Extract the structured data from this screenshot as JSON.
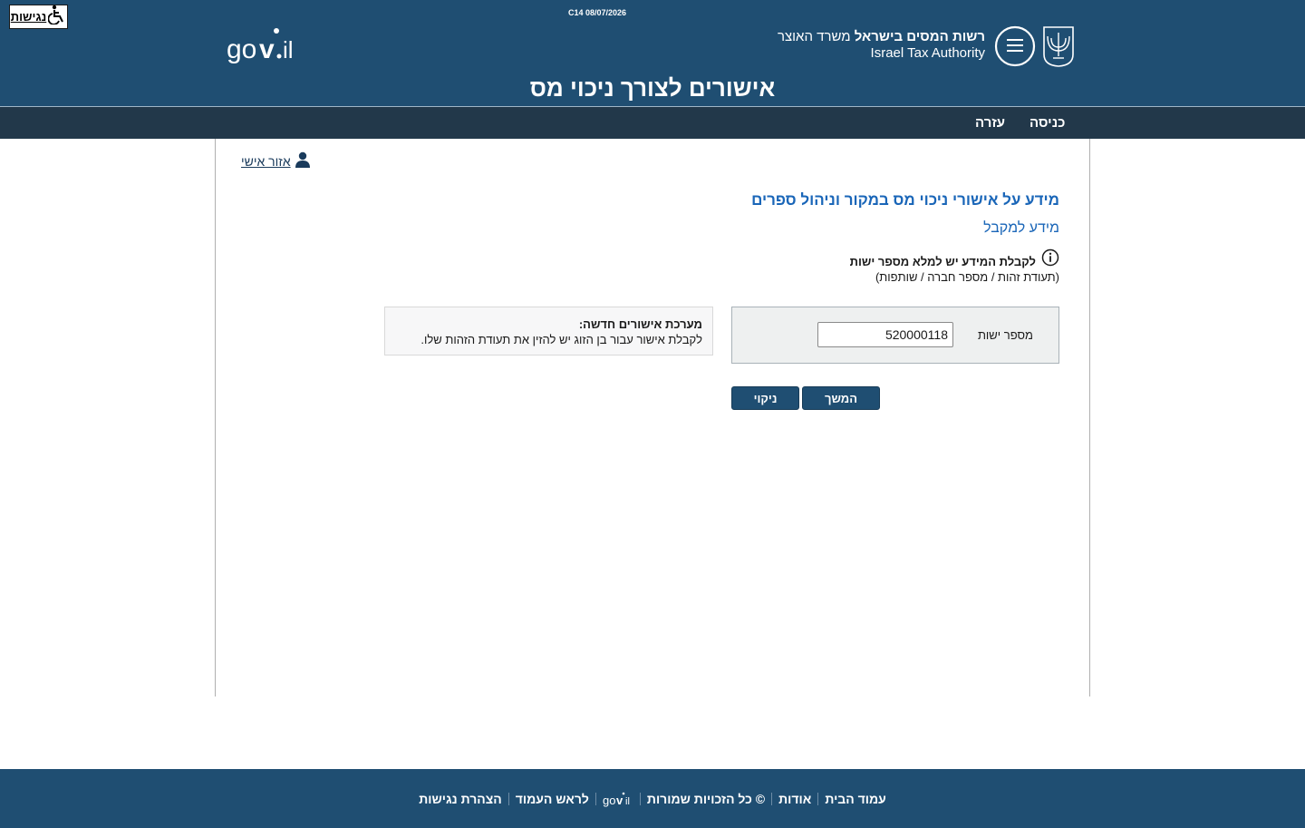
{
  "header": {
    "version": "C14 08/07/2026",
    "accessibility_label": "נגישות",
    "gov_logo_text": "gov.il",
    "org_he_bold": "רשות המסים בישראל",
    "org_he_regular": "משרד האוצר",
    "org_en": "Israel Tax Authority",
    "title": "אישורים לצורך ניכוי מס"
  },
  "nav": {
    "items": [
      {
        "label": "כניסה"
      },
      {
        "label": "עזרה"
      }
    ]
  },
  "main": {
    "personal_area": "אזור אישי",
    "heading": "מידע על אישורי ניכוי מס במקור וניהול ספרים",
    "subheading": "מידע למקבל",
    "info_text": "לקבלת המידע יש למלא מספר ישות",
    "info_sub": "(תעודת זהות / מספר חברה / שותפות)",
    "form": {
      "field_label": "מספר ישות",
      "field_value": "520000118"
    },
    "notice": {
      "title": "מערכת אישורים חדשה:",
      "text": "לקבלת אישור עבור בן הזוג יש להזין את תעודת הזהות שלו."
    },
    "buttons": {
      "continue": "המשך",
      "clear": "ניקוי"
    }
  },
  "footer": {
    "links": [
      {
        "label": "עמוד הבית"
      },
      {
        "label": "אודות"
      },
      {
        "label": "© כל הזכויות שמורות"
      },
      {
        "label": "לראש העמוד"
      },
      {
        "label": "הצהרת נגישות"
      }
    ],
    "gov_logo_text": "gov.il"
  },
  "colors": {
    "header_bg": "#1f4e72",
    "nav_bg": "#22384a",
    "heading": "#1a66b8",
    "button_bg": "#1f4e72",
    "form_bg": "#eef0f0"
  }
}
